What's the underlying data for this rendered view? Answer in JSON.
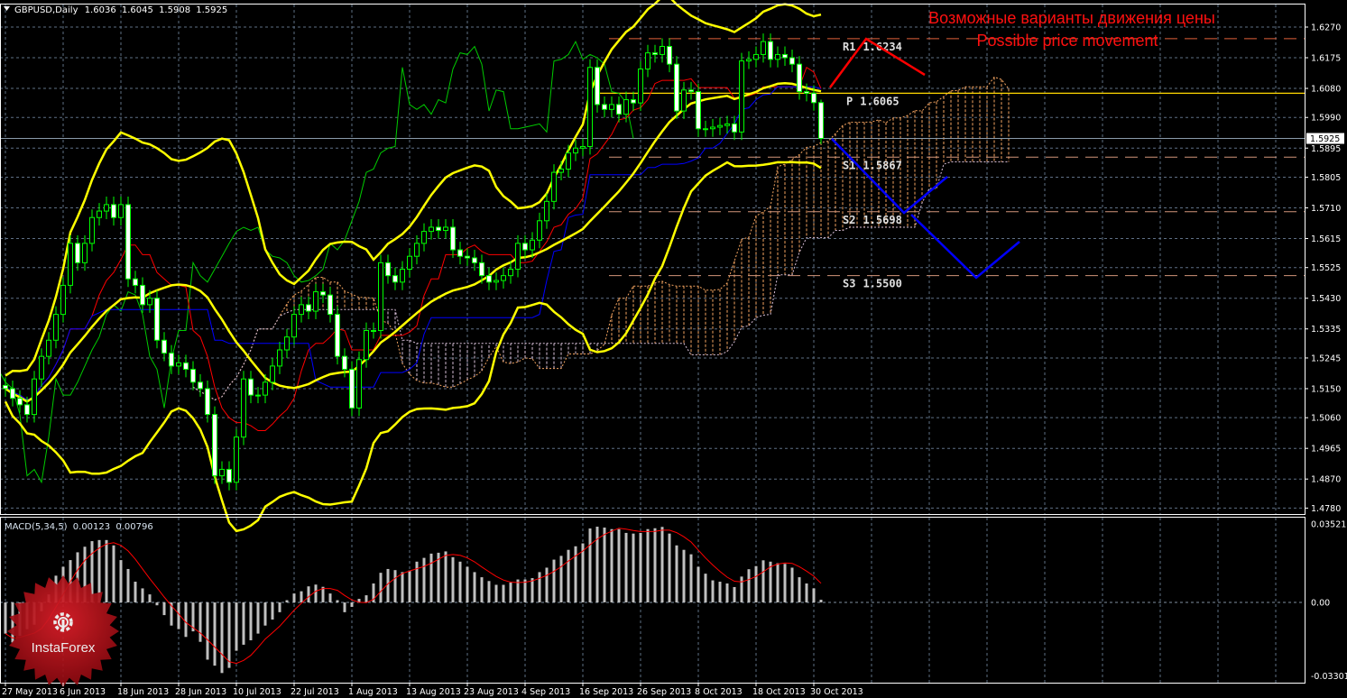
{
  "header": {
    "symbol_timeframe": "GBPUSD,Daily",
    "open": "1.6036",
    "high": "1.6045",
    "low": "1.5908",
    "close": "1.5925"
  },
  "annotation": {
    "ru": "Возможные варианты движения цены",
    "en": "Possible price movement"
  },
  "macd_label": {
    "title": "MACD(5,34,5)",
    "main": "0.00123",
    "signal": "0.00796"
  },
  "logo": {
    "text": "InstaForex",
    "color": "#c8101a"
  },
  "colors": {
    "bullish_outline": "#00ff00",
    "bearish_body": "#ffffff",
    "bollinger": "#ffff00",
    "tenkan": "#ff0000",
    "kijun": "#0000ff",
    "chikou": "#00cc00",
    "cloud_up": "#f4a460",
    "cloud_down": "#d8bfd8",
    "pivot": "#ffd700",
    "levels": "#d2957a",
    "macd_hist": "#c0c0c0",
    "macd_signal": "#ff0000",
    "projection_up": "#ff0000",
    "projection_down": "#0000ff"
  },
  "chart_data": [
    {
      "type": "candlestick",
      "symbol": "GBPUSD",
      "timeframe": "Daily",
      "close": [
        1.515,
        1.512,
        1.51,
        1.507,
        1.518,
        1.525,
        1.53,
        1.538,
        1.547,
        1.56,
        1.554,
        1.56,
        1.568,
        1.57,
        1.572,
        1.568,
        1.572,
        1.549,
        1.547,
        1.541,
        1.543,
        1.53,
        1.526,
        1.522,
        1.523,
        1.521,
        1.517,
        1.515,
        1.507,
        1.488,
        1.49,
        1.486,
        1.5,
        1.518,
        1.513,
        1.513,
        1.517,
        1.522,
        1.527,
        1.531,
        1.538,
        1.541,
        1.539,
        1.545,
        1.544,
        1.538,
        1.525,
        1.521,
        1.509,
        1.524,
        1.533,
        1.533,
        1.554,
        1.55,
        1.548,
        1.552,
        1.556,
        1.56,
        1.5637,
        1.565,
        1.564,
        1.565,
        1.558,
        1.556,
        1.5555,
        1.554,
        1.55,
        1.548,
        1.5485,
        1.55,
        1.552,
        1.56,
        1.558,
        1.561,
        1.567,
        1.573,
        1.582,
        1.583,
        1.588,
        1.5895,
        1.59,
        1.6145,
        1.603,
        1.6015,
        1.603,
        1.6,
        1.6045,
        1.6035,
        1.614,
        1.619,
        1.6185,
        1.621,
        1.6155,
        1.601,
        1.6075,
        1.607,
        1.5955,
        1.5955,
        1.596,
        1.5965,
        1.597,
        1.5945,
        1.6165,
        1.617,
        1.6185,
        1.6225,
        1.617,
        1.6185,
        1.6175,
        1.6155,
        1.607,
        1.6065,
        1.6036,
        1.5925
      ],
      "last_bar": {
        "open": 1.6036,
        "high": 1.6045,
        "low": 1.5908,
        "close": 1.5925
      },
      "current_price": "1.5925",
      "price_axis_ticks": [
        "1.6270",
        "1.6175",
        "1.6080",
        "1.5990",
        "1.5895",
        "1.5805",
        "1.5710",
        "1.5615",
        "1.5525",
        "1.5430",
        "1.5335",
        "1.5245",
        "1.5150",
        "1.5060",
        "1.4965",
        "1.4870",
        "1.4780"
      ],
      "x_tick_labels": [
        "27 May 2013",
        "6 Jun 2013",
        "18 Jun 2013",
        "28 Jun 2013",
        "10 Jul 2013",
        "22 Jul 2013",
        "1 Aug 2013",
        "13 Aug 2013",
        "23 Aug 2013",
        "4 Sep 2013",
        "16 Sep 2013",
        "26 Sep 2013",
        "8 Oct 2013",
        "18 Oct 2013",
        "30 Oct 2013"
      ],
      "indicators": [
        "Bollinger Bands",
        "Ichimoku Kinko Hyo"
      ],
      "levels": [
        {
          "label": "R1",
          "value": "1.6234"
        },
        {
          "label": "P",
          "value": "1.6065"
        },
        {
          "label": "S1",
          "value": "1.5867"
        },
        {
          "label": "S2",
          "value": "1.5698"
        },
        {
          "label": "S3",
          "value": "1.5500"
        }
      ],
      "grid": true
    },
    {
      "type": "bar",
      "title": "MACD(5,34,5)",
      "values": [
        -0.014,
        -0.018,
        -0.015,
        -0.012,
        -0.01,
        -0.004,
        0.0036,
        0.012,
        0.016,
        0.019,
        0.0225,
        0.025,
        0.0275,
        0.028,
        0.028,
        0.0256,
        0.019,
        0.015,
        0.0093,
        0.0063,
        0.0036,
        -0.0013,
        -0.0057,
        -0.0104,
        -0.012,
        -0.0155,
        -0.013,
        -0.0177,
        -0.0257,
        -0.0284,
        -0.0317,
        -0.0294,
        -0.0217,
        -0.019,
        -0.017,
        -0.014,
        -0.0104,
        -0.0077,
        -0.0044,
        0.001,
        0.004,
        0.005,
        0.0072,
        0.008,
        0.007,
        0.004,
        0.001,
        -0.0044,
        -0.002,
        0.0016,
        0.0032,
        0.0085,
        0.0133,
        0.015,
        0.0145,
        0.0136,
        0.0143,
        0.0183,
        0.02,
        0.0219,
        0.0223,
        0.0229,
        0.0203,
        0.0183,
        0.016,
        0.0136,
        0.0113,
        0.0096,
        0.0079,
        0.0079,
        0.0089,
        0.0103,
        0.0103,
        0.0109,
        0.0136,
        0.0156,
        0.0192,
        0.0209,
        0.0236,
        0.0252,
        0.0265,
        0.0332,
        0.034,
        0.0336,
        0.0329,
        0.0329,
        0.0312,
        0.0309,
        0.0312,
        0.0329,
        0.0333,
        0.0339,
        0.0309,
        0.0256,
        0.0236,
        0.0216,
        0.016,
        0.0129,
        0.0099,
        0.0093,
        0.0085,
        0.0069,
        0.0116,
        0.0149,
        0.0163,
        0.0189,
        0.0183,
        0.0176,
        0.0173,
        0.0156,
        0.0113,
        0.0085,
        0.0063,
        0.0012
      ],
      "y_ticks": [
        "0.03521",
        "0.00",
        "-0.03301"
      ],
      "ylim": [
        -0.03301,
        0.03521
      ]
    }
  ]
}
